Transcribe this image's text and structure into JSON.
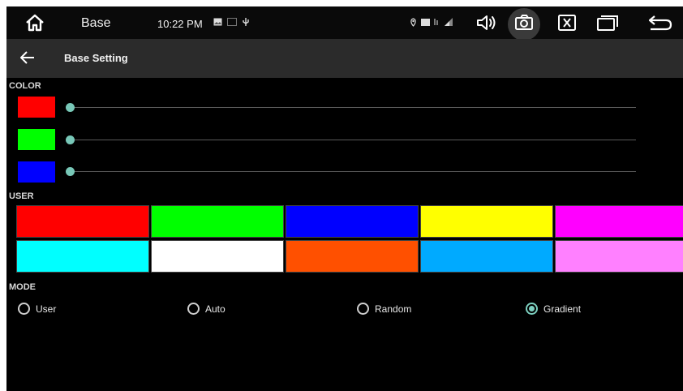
{
  "status_bar": {
    "app_name": "Base",
    "time": "10:22 PM",
    "icons": [
      "home-icon",
      "image-icon",
      "sd-card-icon",
      "usb-icon",
      "location-icon",
      "battery-icon",
      "signal-icon",
      "volume-icon",
      "camera-icon",
      "close-box-icon",
      "windows-icon",
      "back-icon"
    ]
  },
  "title_bar": {
    "title": "Base Setting"
  },
  "color_section": {
    "label": "COLOR",
    "sliders": [
      {
        "name": "red",
        "color": "#ff0000",
        "value": 0
      },
      {
        "name": "green",
        "color": "#00ff00",
        "value": 0
      },
      {
        "name": "blue",
        "color": "#0000ff",
        "value": 0
      }
    ]
  },
  "user_section": {
    "label": "USER",
    "colors": [
      [
        "#ff0000",
        "#00ff00",
        "#0000ff",
        "#ffff00",
        "#ff00ff"
      ],
      [
        "#00ffff",
        "#ffffff",
        "#ff5000",
        "#00aaff",
        "#ff80ff"
      ]
    ]
  },
  "mode_section": {
    "label": "MODE",
    "options": [
      {
        "label": "User",
        "checked": false
      },
      {
        "label": "Auto",
        "checked": false
      },
      {
        "label": "Random",
        "checked": false
      },
      {
        "label": "Gradient",
        "checked": true
      }
    ]
  },
  "accent_color": "#7dd0c0"
}
